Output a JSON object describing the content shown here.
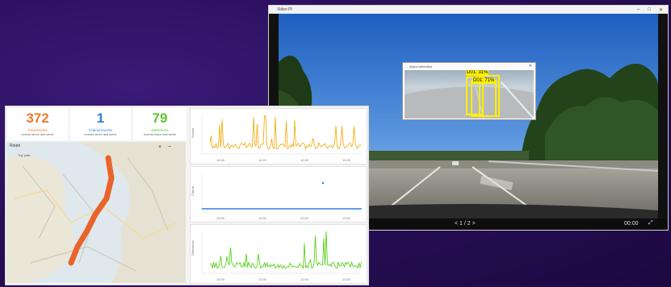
{
  "video_window": {
    "title": "Video PI",
    "controls": [
      "–",
      "□",
      "✕"
    ],
    "detection_popup": {
      "title": "object detection",
      "detections": [
        {
          "label": "D01: 31%"
        },
        {
          "label": "D01: 71%"
        }
      ]
    },
    "nav_label": "< 1 / 2 >",
    "time_label": "00:00",
    "expand_label": "⤢"
  },
  "dashboard": {
    "stats": [
      {
        "value": "372",
        "label": "Total Events",
        "sub": "events since last week",
        "color": "#f07a2e"
      },
      {
        "value": "1",
        "label": "Critical Events",
        "sub": "events since last week",
        "color": "#2f7fe0"
      },
      {
        "value": "79",
        "label": "Detections",
        "sub": "events since last week",
        "color": "#5cc62a"
      }
    ],
    "map": {
      "title": "Route",
      "legend": "Trip path",
      "zoom_in": "+",
      "zoom_out": "−",
      "route_color": "#e8642a"
    },
    "charts": [
      {
        "name": "events-chart",
        "color": "#f0a800",
        "ylabel": "Events",
        "xticks": [
          "10:00",
          "11:00",
          "12:00",
          "13:00"
        ]
      },
      {
        "name": "critical-chart",
        "color": "#2f7fe0",
        "ylabel": "Critical",
        "xticks": [
          "10:00",
          "11:00",
          "12:00",
          "13:00"
        ]
      },
      {
        "name": "detections-chart",
        "color": "#44cc00",
        "ylabel": "Detections",
        "xticks": [
          "10:00",
          "11:00",
          "12:00",
          "13:00"
        ]
      }
    ]
  }
}
